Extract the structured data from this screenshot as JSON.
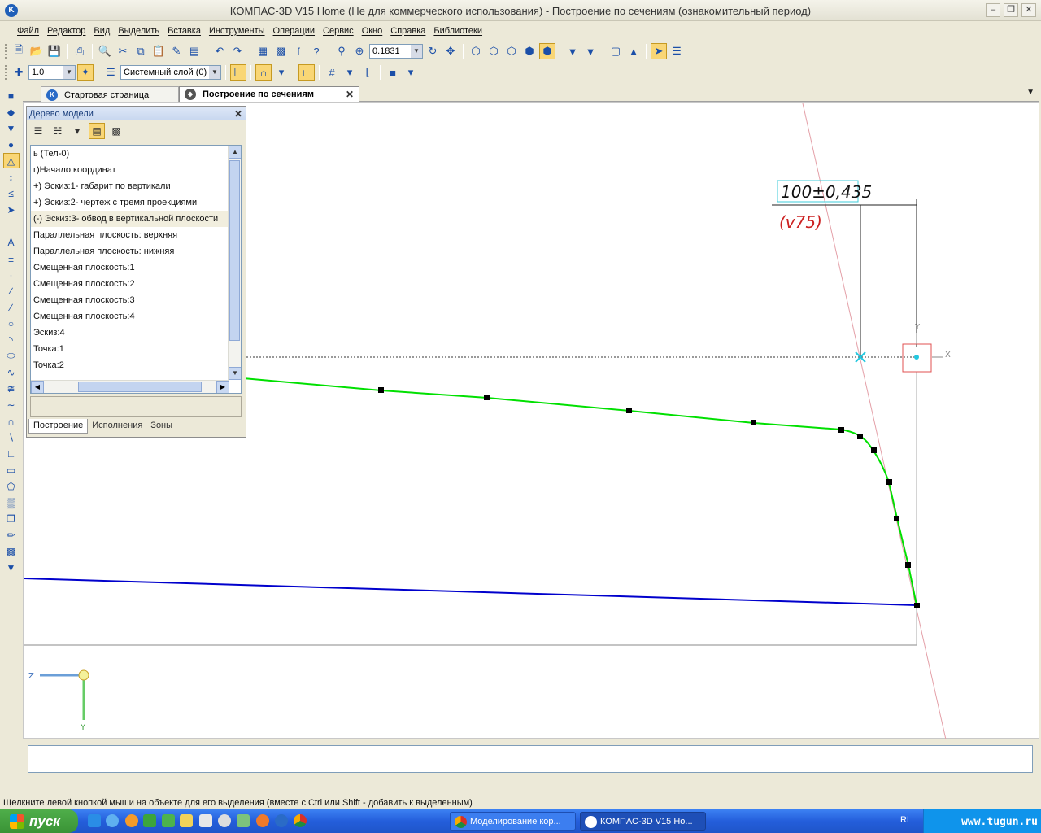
{
  "window": {
    "title": "КОМПАС-3D V15 Home (Не для коммерческого использования) - Построение по сечениям (ознакомительный период)"
  },
  "menu": [
    "Файл",
    "Редактор",
    "Вид",
    "Выделить",
    "Вставка",
    "Инструменты",
    "Операции",
    "Сервис",
    "Окно",
    "Справка",
    "Библиотеки"
  ],
  "toolbar": {
    "zoom_value": "0.1831",
    "step_value": "1.0",
    "layer_value": "Системный слой (0)"
  },
  "tabs": {
    "start": "Стартовая страница",
    "active": "Построение по сечениям"
  },
  "tree": {
    "title": "Дерево модели",
    "items": [
      "ь (Тел-0)",
      "г)Начало координат",
      "+) Эскиз:1- габарит по вертикали",
      "+) Эскиз:2- чертеж с тремя проекциями",
      "(-) Эскиз:3- обвод в вертикальной плоскости",
      "Параллельная плоскость: верхняя",
      "Параллельная плоскость: нижняя",
      "Смещенная плоскость:1",
      "Смещенная плоскость:2",
      "Смещенная плоскость:3",
      "Смещенная плоскость:4",
      "Эскиз:4",
      "Точка:1",
      "Точка:2"
    ],
    "tabs": [
      "Построение",
      "Исполнения",
      "Зоны"
    ]
  },
  "drawing": {
    "dimension_text": "100±0,435",
    "dimension_ref": "(v75)",
    "axis_x": "X",
    "axis_y": "Y",
    "axis_z": "Z",
    "colors": {
      "profile": "#00e000",
      "base": "#0000cc",
      "dimension_ref": "#cc2222"
    }
  },
  "status": {
    "hint": "Щелкните левой кнопкой мыши на объекте для его выделения (вместе с Ctrl или Shift - добавить к выделенным)"
  },
  "taskbar": {
    "start": "пуск",
    "task1": "Моделирование кор...",
    "task2": "КОМПАС-3D V15 Ho...",
    "lang": "RL",
    "watermark": "www.tugun.ru"
  }
}
